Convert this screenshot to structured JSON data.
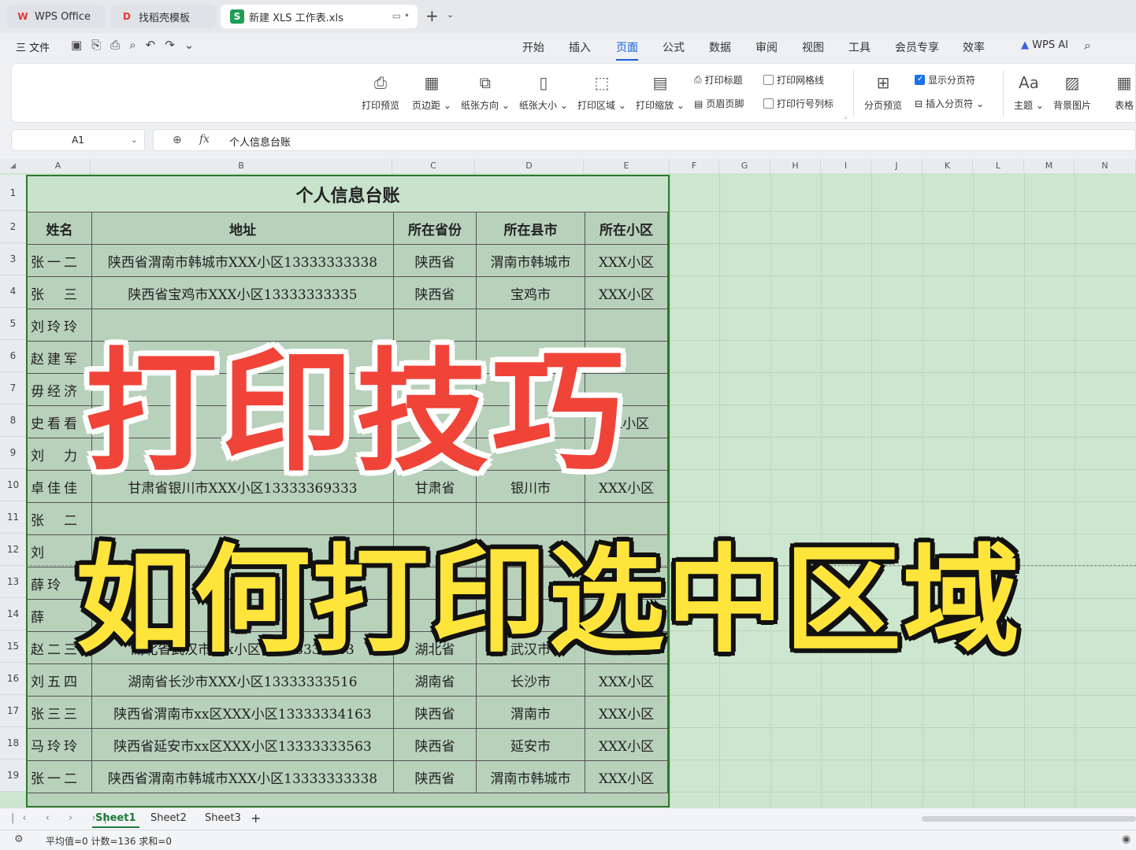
{
  "tabs": [
    {
      "label": "WPS Office",
      "icon": "W"
    },
    {
      "label": "找稻壳模板",
      "icon": "D"
    },
    {
      "label": "新建 XLS 工作表.xls",
      "icon": "S"
    }
  ],
  "menu": {
    "file": "三 文件",
    "items": [
      "开始",
      "插入",
      "页面",
      "公式",
      "数据",
      "审阅",
      "视图",
      "工具",
      "会员专享",
      "效率"
    ],
    "active": "页面",
    "wps_ai": "WPS AI"
  },
  "ribbon": {
    "buttons": [
      "打印预览",
      "页边距",
      "纸张方向",
      "纸张大小",
      "打印区域",
      "打印缩放"
    ],
    "print_title": "打印标题",
    "header_footer": "页眉页脚",
    "print_grid": "打印网格线",
    "print_rowcol": "打印行号列标",
    "show_breaks": "显示分页符",
    "insert_break": "插入分页符",
    "page_preview": "分页预览",
    "theme": "主题",
    "bg_image": "背景图片",
    "table": "表格"
  },
  "formula_bar": {
    "cell": "A1",
    "value": "个人信息台账"
  },
  "columns": [
    "A",
    "B",
    "C",
    "D",
    "E",
    "F",
    "G",
    "H",
    "I",
    "J",
    "K",
    "L",
    "M",
    "N"
  ],
  "rows": [
    "1",
    "2",
    "3",
    "4",
    "5",
    "6",
    "7",
    "8",
    "9",
    "10",
    "11",
    "12",
    "13",
    "14",
    "15",
    "16",
    "17",
    "18",
    "19"
  ],
  "table": {
    "title": "个人信息台账",
    "headers": [
      "姓名",
      "地址",
      "所在省份",
      "所在县市",
      "所在小区"
    ],
    "data": [
      [
        "张一二",
        "陕西省渭南市韩城市XXX小区13333333338",
        "陕西省",
        "渭南市韩城市",
        "XXX小区"
      ],
      [
        "张　三",
        "陕西省宝鸡市XXX小区13333333335",
        "陕西省",
        "宝鸡市",
        "XXX小区"
      ],
      [
        "刘玲玲",
        "",
        "",
        "",
        ""
      ],
      [
        "赵建军",
        "",
        "",
        "",
        ""
      ],
      [
        "毋经济",
        "",
        "",
        "",
        ""
      ],
      [
        "史看看",
        "",
        "",
        "",
        "XX小区"
      ],
      [
        "刘　力",
        "",
        "",
        "",
        ""
      ],
      [
        "卓佳佳",
        "甘肃省银川市XXX小区13333369333",
        "甘肃省",
        "银川市",
        "XXX小区"
      ],
      [
        "张　二",
        "",
        "",
        "",
        ""
      ],
      [
        "刘",
        "",
        "",
        "",
        ""
      ],
      [
        "薛玲",
        "",
        "",
        "",
        ""
      ],
      [
        "薛",
        "",
        "",
        "",
        ""
      ],
      [
        "赵二三",
        "湖北省武汉市xxx小区13333333633",
        "湖北省",
        "武汉市",
        "xxx小区"
      ],
      [
        "刘五四",
        "湖南省长沙市XXX小区13333333516",
        "湖南省",
        "长沙市",
        "XXX小区"
      ],
      [
        "张三三",
        "陕西省渭南市xx区XXX小区13333334163",
        "陕西省",
        "渭南市",
        "XXX小区"
      ],
      [
        "马玲玲",
        "陕西省延安市xx区XXX小区13333333563",
        "陕西省",
        "延安市",
        "XXX小区"
      ],
      [
        "张一二",
        "陕西省渭南市韩城市XXX小区13333333338",
        "陕西省",
        "渭南市韩城市",
        "XXX小区"
      ]
    ]
  },
  "overlay": {
    "line1": "打印技巧",
    "line2": "如何打印选中区域"
  },
  "sheets": [
    "Sheet1",
    "Sheet2",
    "Sheet3"
  ],
  "status": "平均值=0  计数=136  求和=0"
}
